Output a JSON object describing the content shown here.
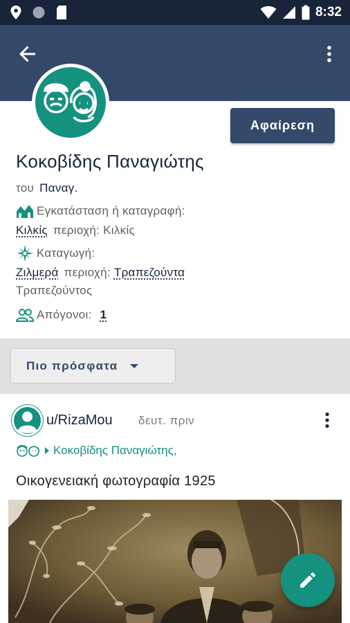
{
  "status_bar": {
    "time": "8:32",
    "icons": [
      "location-icon",
      "circle-icon",
      "sd-card-icon",
      "wifi-icon",
      "signal-icon",
      "battery-icon"
    ]
  },
  "app_bar": {
    "back_icon": "arrow-back-icon",
    "menu_icon": "more-vert-icon",
    "color": "#34486a"
  },
  "profile": {
    "avatar_icon": "couple-faces-icon",
    "remove_button": "Αφαίρεση",
    "name": "Κοκοβίδης Παναγιώτης",
    "father_prefix": "του",
    "father_name": "Παναγ.",
    "settlement_label": "Εγκατάσταση ή καταγραφή:",
    "settlement_place": "Κιλκίς",
    "settlement_region_label": "περιοχή:",
    "settlement_region": "Κιλκίς",
    "origin_label": "Καταγωγή:",
    "origin_place": "Ζιλμερά",
    "origin_region_label": "περιοχή:",
    "origin_region": "Τραπεζούντα",
    "origin_subregion": "Τραπεζούντος",
    "descendants_label": "Απόγονοι:",
    "descendants_count": "1"
  },
  "sort": {
    "selected": "Πιο πρόσφατα"
  },
  "post": {
    "user": "u/RizaMou",
    "time": "δευτ. πριν",
    "tag": "Κοκοβίδης Παναγιώτης,",
    "title": "Οικογενειακή φωτογραφία 1925"
  },
  "colors": {
    "accent": "#14917f",
    "primary_dark": "#17243a",
    "primary": "#34486a"
  },
  "fab_icon": "pencil-icon"
}
